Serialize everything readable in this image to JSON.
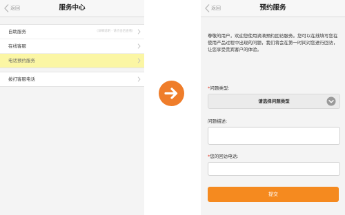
{
  "left": {
    "nav": {
      "back_label": "返回",
      "title": "服务中心"
    },
    "group1": [
      {
        "label": "自助服务",
        "extra": "(详细说明 · 请点击后查看)"
      },
      {
        "label": "在线客服",
        "extra": ""
      },
      {
        "label": "电话预约服务",
        "extra": ""
      }
    ],
    "group2": [
      {
        "label": "拨打客服电话",
        "extra": ""
      }
    ]
  },
  "right": {
    "nav": {
      "back_label": "返回",
      "title": "预约服务"
    },
    "intro": "尊敬的用户，欢迎您使用滴滴预约回访服务。您可以在线填写您在使用产品过程中出现的问题，我们将会在第一时间对您进行回访，让您享受贵宾客户的体验。",
    "type_label": "问题类型:",
    "type_select": "请选择问题类型",
    "desc_label": "问题描述:",
    "phone_label": "您的回访电话:",
    "required_mark": "*",
    "submit_label": "提交"
  },
  "colors": {
    "accent": "#f58a1f",
    "arrow_circle": "#ef7d2a",
    "highlight": "#fbf6a4",
    "required": "#e0301e"
  },
  "icons": [
    "chevron-left-icon",
    "chevron-right-icon",
    "arrow-right-icon",
    "chevron-down-circle-icon"
  ]
}
